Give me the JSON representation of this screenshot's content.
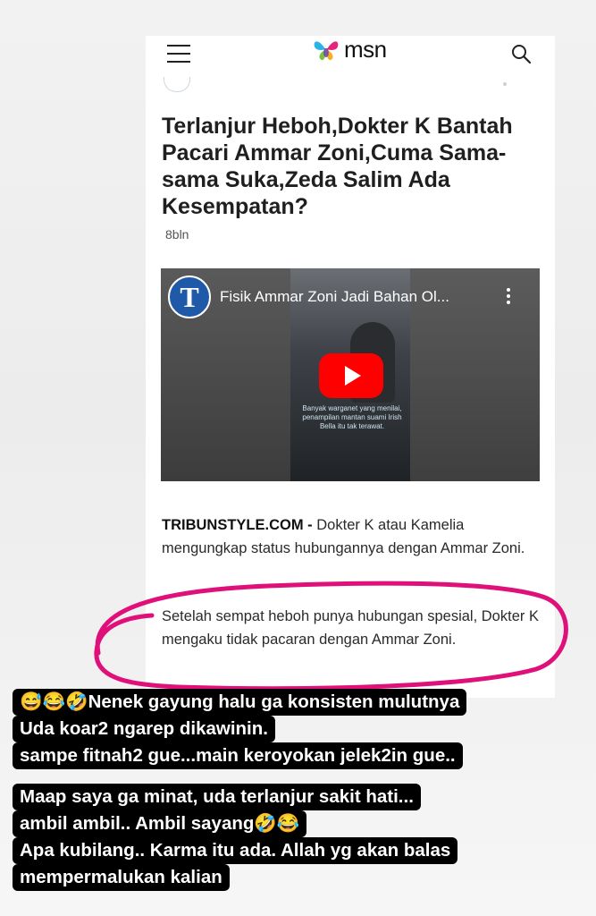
{
  "header": {
    "logo_text": "msn",
    "menu_icon": "hamburger-menu-icon",
    "search_icon": "search-icon"
  },
  "article": {
    "headline": "Terlanjur Heboh,Dokter K Bantah Pacari Ammar Zoni,Cuma Sama-sama Suka,Zeda Salim Ada Kesempatan?",
    "age": "8bln",
    "video": {
      "channel_initial": "T",
      "title": "Fisik Ammar Zoni Jadi Bahan Ol...",
      "overlay_caption": "Banyak warganet yang menilai, penampilan mantan suami Irish Bella itu tak terawat."
    },
    "source": "TRIBUNSTYLE.COM -",
    "paragraph1": "Dokter K atau Kamelia mengungkap status hubungannya dengan Ammar Zoni.",
    "paragraph2": "Setelah sempat heboh punya hubungan spesial, Dokter K mengaku tidak pacaran dengan Ammar Zoni."
  },
  "annotation": {
    "circle_color": "#e0107a"
  },
  "comments": {
    "block1": [
      "😅😂🤣Nenek gayung halu ga konsisten mulutnya",
      "Uda koar2 ngarep dikawinin.",
      "sampe fitnah2 gue...main keroyokan  jelek2in gue.."
    ],
    "block2": [
      "Maap saya ga minat, uda terlanjur sakit hati...",
      "ambil ambil.. Ambil sayang🤣😂",
      "Apa kubilang.. Karma itu ada. Allah yg akan balas",
      "mempermalukan kalian"
    ]
  }
}
